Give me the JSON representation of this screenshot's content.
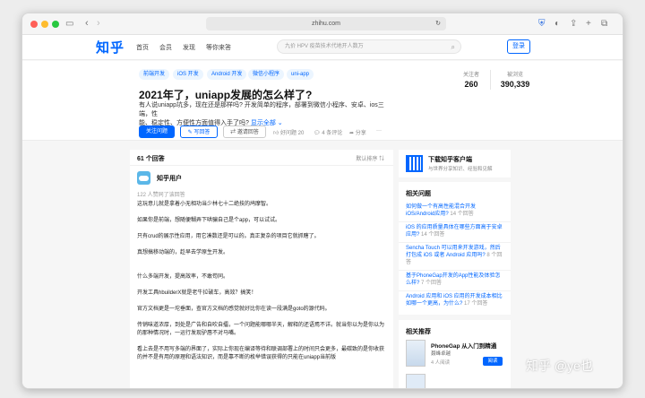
{
  "browser": {
    "url": "zhihu.com"
  },
  "site": {
    "logo": "知乎",
    "nav": [
      "首页",
      "会员",
      "发现",
      "等你来答"
    ],
    "search_placeholder": "九价 HPV 疫苗技术代地开人数万",
    "login_label": "登录"
  },
  "question": {
    "tags": [
      "前端开发",
      "iOS 开发",
      "Android 开发",
      "微信小程序",
      "uni-app"
    ],
    "title": "2021年了，uniapp发展的怎么样了?",
    "desc_line1": "有人说uniapp坑多，现在还是那样吗? 开发简单的程序，部署到微信小程序、安卓、ios三端，性",
    "desc_line2": "能、稳定性、方便性方面值得入手了吗?",
    "desc_more": "显示全部",
    "follow_label": "关注问题",
    "answer_label": "写回答",
    "invite_label": "邀请回答",
    "likes_label": "好问题 20",
    "comments_label": "4 条评论",
    "share_label": "分享",
    "followers_label": "关注者",
    "followers_value": "260",
    "views_label": "被浏览",
    "views_value": "390,339"
  },
  "answers": {
    "count_label": "61 个回答",
    "sort_label": "默认排序",
    "author": "知乎用户",
    "likes": "122 人赞同了该回答",
    "paragraphs": [
      "这玩意儿就是拿着小无相功当少林七十二绝技的鸠摩智。",
      "如果你是前端，想随便糊弄下哄骗自己是个app，可以试试。",
      "只有crud的展示性应用，用它凑数还是可以的。真正复杂的项目它就抓瞎了。",
      "真想搞移动端的，趁早去学原生开发。",
      "什么多端开发，提高效率，不敢苟同。",
      "开发工具hbuilderX就是老牛拉破车，高效？搞笑！",
      "官方文档更是一坨垂面，查官方文档的感觉就好比你在读一段满是goto的源代码。",
      "传销味道浓厚，到处是广告和自吹自擂，一个问题能哪哪半天，解释的还语焉不详。就当你以为是你以为的那种情况时，一运行发现驴唇不对马嘴。",
      "看上去是不用写多端的界面了，实际上你现在编译等待和联调部署上的时间只会更多，最碳致的是你收获的并不是有用的原理和语法知识，而是靠不断的枚举错误获得的只能在uniapp当前版"
    ]
  },
  "sidebar": {
    "download_title": "下载知乎客户端",
    "download_sub": "与世界分享知识、经验和见解",
    "related_title": "相关问题",
    "related": [
      {
        "q": "如何做一个有高性能混合开发 iOS/Android应用?",
        "n": "14 个回答"
      },
      {
        "q": "iOS 的应用质量具体在哪些方面高于安卓应用?",
        "n": "14 个回答"
      },
      {
        "q": "Sencha Touch 可以用来开发游戏，然后打包成 iOS 或者 Android 应用吗?",
        "n": "8 个回答"
      },
      {
        "q": "基于PhoneGap开发的App性能及体验怎么样?",
        "n": "7 个回答"
      },
      {
        "q": "Android 应用和 iOS 应用的开发成本相比如哪一个更高，为什么?",
        "n": "17 个回答"
      }
    ],
    "recommend_title": "相关推荐",
    "book_title": "PhoneGap 从入门到精通",
    "book_author": "聂峰卓越",
    "book_readers": "4 人阅读",
    "book_btn": "阅读"
  },
  "watermark": "知乎 @ye也"
}
